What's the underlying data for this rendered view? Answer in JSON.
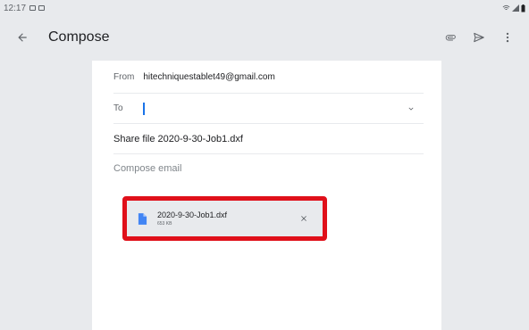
{
  "status_bar": {
    "time": "12:17",
    "left_icons": [
      "image-icon",
      "photo-icon"
    ],
    "right_icons": [
      "wifi-icon",
      "signal-icon",
      "battery-icon"
    ]
  },
  "app_bar": {
    "title": "Compose",
    "back_icon": "arrow-back-icon",
    "actions": [
      "attach-icon",
      "send-icon",
      "more-vert-icon"
    ]
  },
  "compose": {
    "from_label": "From",
    "from_value": "hitechniquestablet49@gmail.com",
    "to_label": "To",
    "to_value": "",
    "subject": "Share file 2020-9-30-Job1.dxf",
    "body_placeholder": "Compose email"
  },
  "attachment": {
    "file_name": "2020-9-30-Job1.dxf",
    "file_size": "653 KB",
    "icon": "file-icon"
  },
  "colors": {
    "background": "#e8eaed",
    "card": "#ffffff",
    "accent": "#1a73e8",
    "highlight": "#e0101a"
  }
}
